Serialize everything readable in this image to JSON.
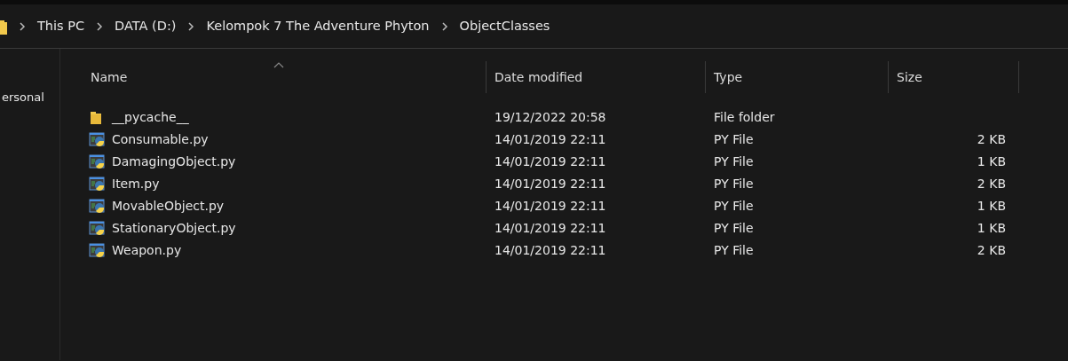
{
  "breadcrumb": [
    "This PC",
    "DATA (D:)",
    "Kelompok 7 The Adventure Phyton",
    "ObjectClasses"
  ],
  "nav_pane": {
    "items": [
      "ersonal"
    ]
  },
  "table": {
    "columns": [
      {
        "label": "Name",
        "sorted": true
      },
      {
        "label": "Date modified",
        "sorted": false
      },
      {
        "label": "Type",
        "sorted": false
      },
      {
        "label": "Size",
        "sorted": false
      }
    ],
    "rows": [
      {
        "kind": "folder",
        "name": "__pycache__",
        "date": "19/12/2022 20:58",
        "type": "File folder"
      },
      {
        "kind": "py",
        "name": "Consumable.py",
        "date": "14/01/2019 22:11",
        "type": "PY File",
        "size": "2 KB"
      },
      {
        "kind": "py",
        "name": "DamagingObject.py",
        "date": "14/01/2019 22:11",
        "type": "PY File",
        "size": "1 KB"
      },
      {
        "kind": "py",
        "name": "Item.py",
        "date": "14/01/2019 22:11",
        "type": "PY File",
        "size": "2 KB"
      },
      {
        "kind": "py",
        "name": "MovableObject.py",
        "date": "14/01/2019 22:11",
        "type": "PY File",
        "size": "1 KB"
      },
      {
        "kind": "py",
        "name": "StationaryObject.py",
        "date": "14/01/2019 22:11",
        "type": "PY File",
        "size": "1 KB"
      },
      {
        "kind": "py",
        "name": "Weapon.py",
        "date": "14/01/2019 22:11",
        "type": "PY File",
        "size": "2 KB"
      }
    ]
  }
}
